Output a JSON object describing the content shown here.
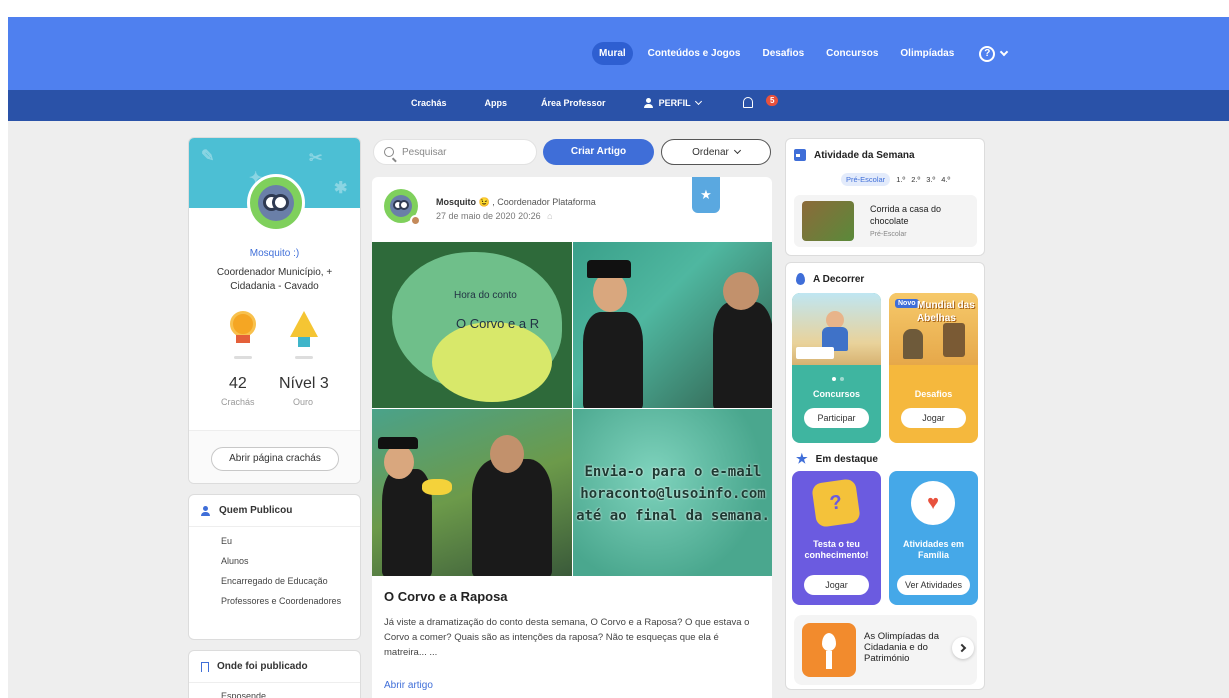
{
  "nav": {
    "items": [
      {
        "label": "Mural",
        "active": true
      },
      {
        "label": "Conteúdos e Jogos"
      },
      {
        "label": "Desafios"
      },
      {
        "label": "Concursos"
      },
      {
        "label": "Olimpíadas"
      }
    ],
    "help": "?"
  },
  "subnav": {
    "crachas": "Crachás",
    "apps": "Apps",
    "professor": "Área Professor",
    "perfil": "PERFIL",
    "notifications": "5"
  },
  "profile": {
    "name": "Mosquito :)",
    "role": "Coordenador Município, + Cidadania - Cavado",
    "badges_count": "42",
    "badges_label": "Crachás",
    "level": "Nível 3",
    "level_label": "Ouro",
    "button": "Abrir página crachás"
  },
  "who_published": {
    "title": "Quem Publicou",
    "options": [
      "Eu",
      "Alunos",
      "Encarregado de Educação",
      "Professores e Coordenadores"
    ]
  },
  "where_published": {
    "title": "Onde foi publicado",
    "first_option": "Esposende"
  },
  "toolbar": {
    "search_placeholder": "Pesquisar",
    "create": "Criar Artigo",
    "sort": "Ordenar"
  },
  "post": {
    "author": "Mosquito",
    "author_emoji": "😉",
    "author_role": ", Coordenador Plataforma",
    "date": "27 de maio de 2020 20:26",
    "image_text_1": "Hora do conto",
    "image_text_2": "O Corvo e a R",
    "image_text_3": "Envia-o para o e-mail",
    "image_text_4": "horaconto@lusoinfo.com",
    "image_text_5": "até ao final da semana.",
    "title": "O Corvo e a Raposa",
    "body": "Já viste a dramatização do conto desta semana, O Corvo e a Raposa? O que estava o Corvo a comer? Quais são as intenções da raposa? Não te esqueças que ela é matreira... ...",
    "link": "Abrir artigo"
  },
  "week": {
    "title": "Atividade da Semana",
    "levels": [
      "Pré-Escolar",
      "1.º",
      "2.º",
      "3.º",
      "4.º"
    ],
    "activity_title": "Corrida a casa do chocolate",
    "activity_level": "Pré-Escolar"
  },
  "ongoing": {
    "title": "A Decorrer",
    "concursos_label": "Concursos",
    "concursos_button": "Participar",
    "desafios_label": "Desafios",
    "desafios_button": "Jogar",
    "novo": "Novo",
    "abelhas": "Mundial das Abelhas"
  },
  "featured": {
    "title": "Em destaque",
    "card1_label": "Testa o teu conhecimento!",
    "card1_button": "Jogar",
    "card2_label": "Atividades em Família",
    "card2_button": "Ver Atividades",
    "olympics": "As Olimpíadas da Cidadania e do Património"
  }
}
